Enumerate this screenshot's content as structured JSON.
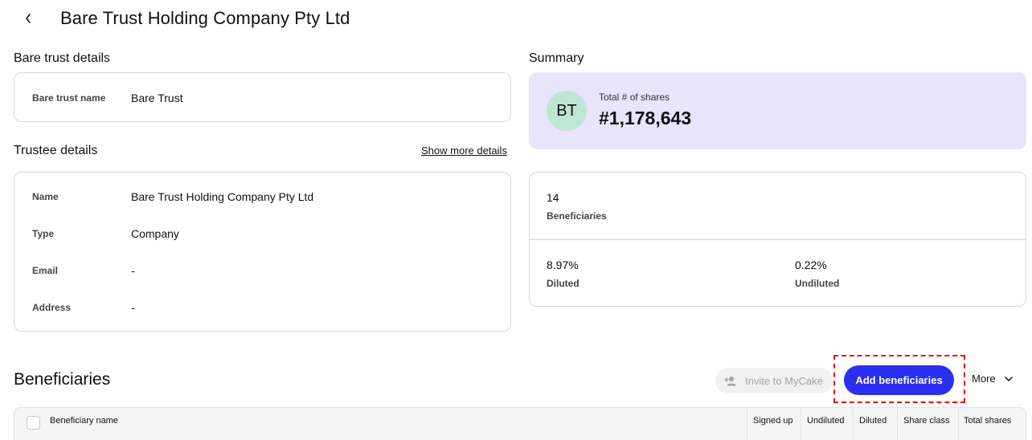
{
  "header": {
    "title": "Bare Trust Holding Company Pty Ltd"
  },
  "bare_trust": {
    "section_title": "Bare trust details",
    "name_label": "Bare trust name",
    "name_value": "Bare Trust"
  },
  "trustee": {
    "section_title": "Trustee details",
    "show_more": "Show more details",
    "fields": [
      {
        "label": "Name",
        "value": "Bare Trust Holding Company Pty Ltd"
      },
      {
        "label": "Type",
        "value": "Company"
      },
      {
        "label": "Email",
        "value": "-"
      },
      {
        "label": "Address",
        "value": "-"
      }
    ]
  },
  "summary": {
    "section_title": "Summary",
    "avatar_initials": "BT",
    "total_label": "Total # of shares",
    "total_value": "#1,178,643",
    "beneficiaries_count": "14",
    "beneficiaries_label": "Beneficiaries",
    "diluted_value": "8.97%",
    "diluted_label": "Diluted",
    "undiluted_value": "0.22%",
    "undiluted_label": "Undiluted"
  },
  "beneficiaries": {
    "title": "Beneficiaries",
    "invite_label": "Invite to MyCake",
    "add_label": "Add beneficiaries",
    "more_label": "More",
    "columns": [
      "Beneficiary name",
      "Signed up",
      "Undiluted",
      "Diluted",
      "Share class",
      "Total shares"
    ]
  },
  "colors": {
    "primary": "#2a2ff2",
    "summary_bg": "#e7e4fb",
    "avatar_bg": "#bfe6d3",
    "highlight": "#e11111"
  },
  "icons": [
    "chevron-left-icon",
    "add-person-icon",
    "chevron-down-icon"
  ]
}
